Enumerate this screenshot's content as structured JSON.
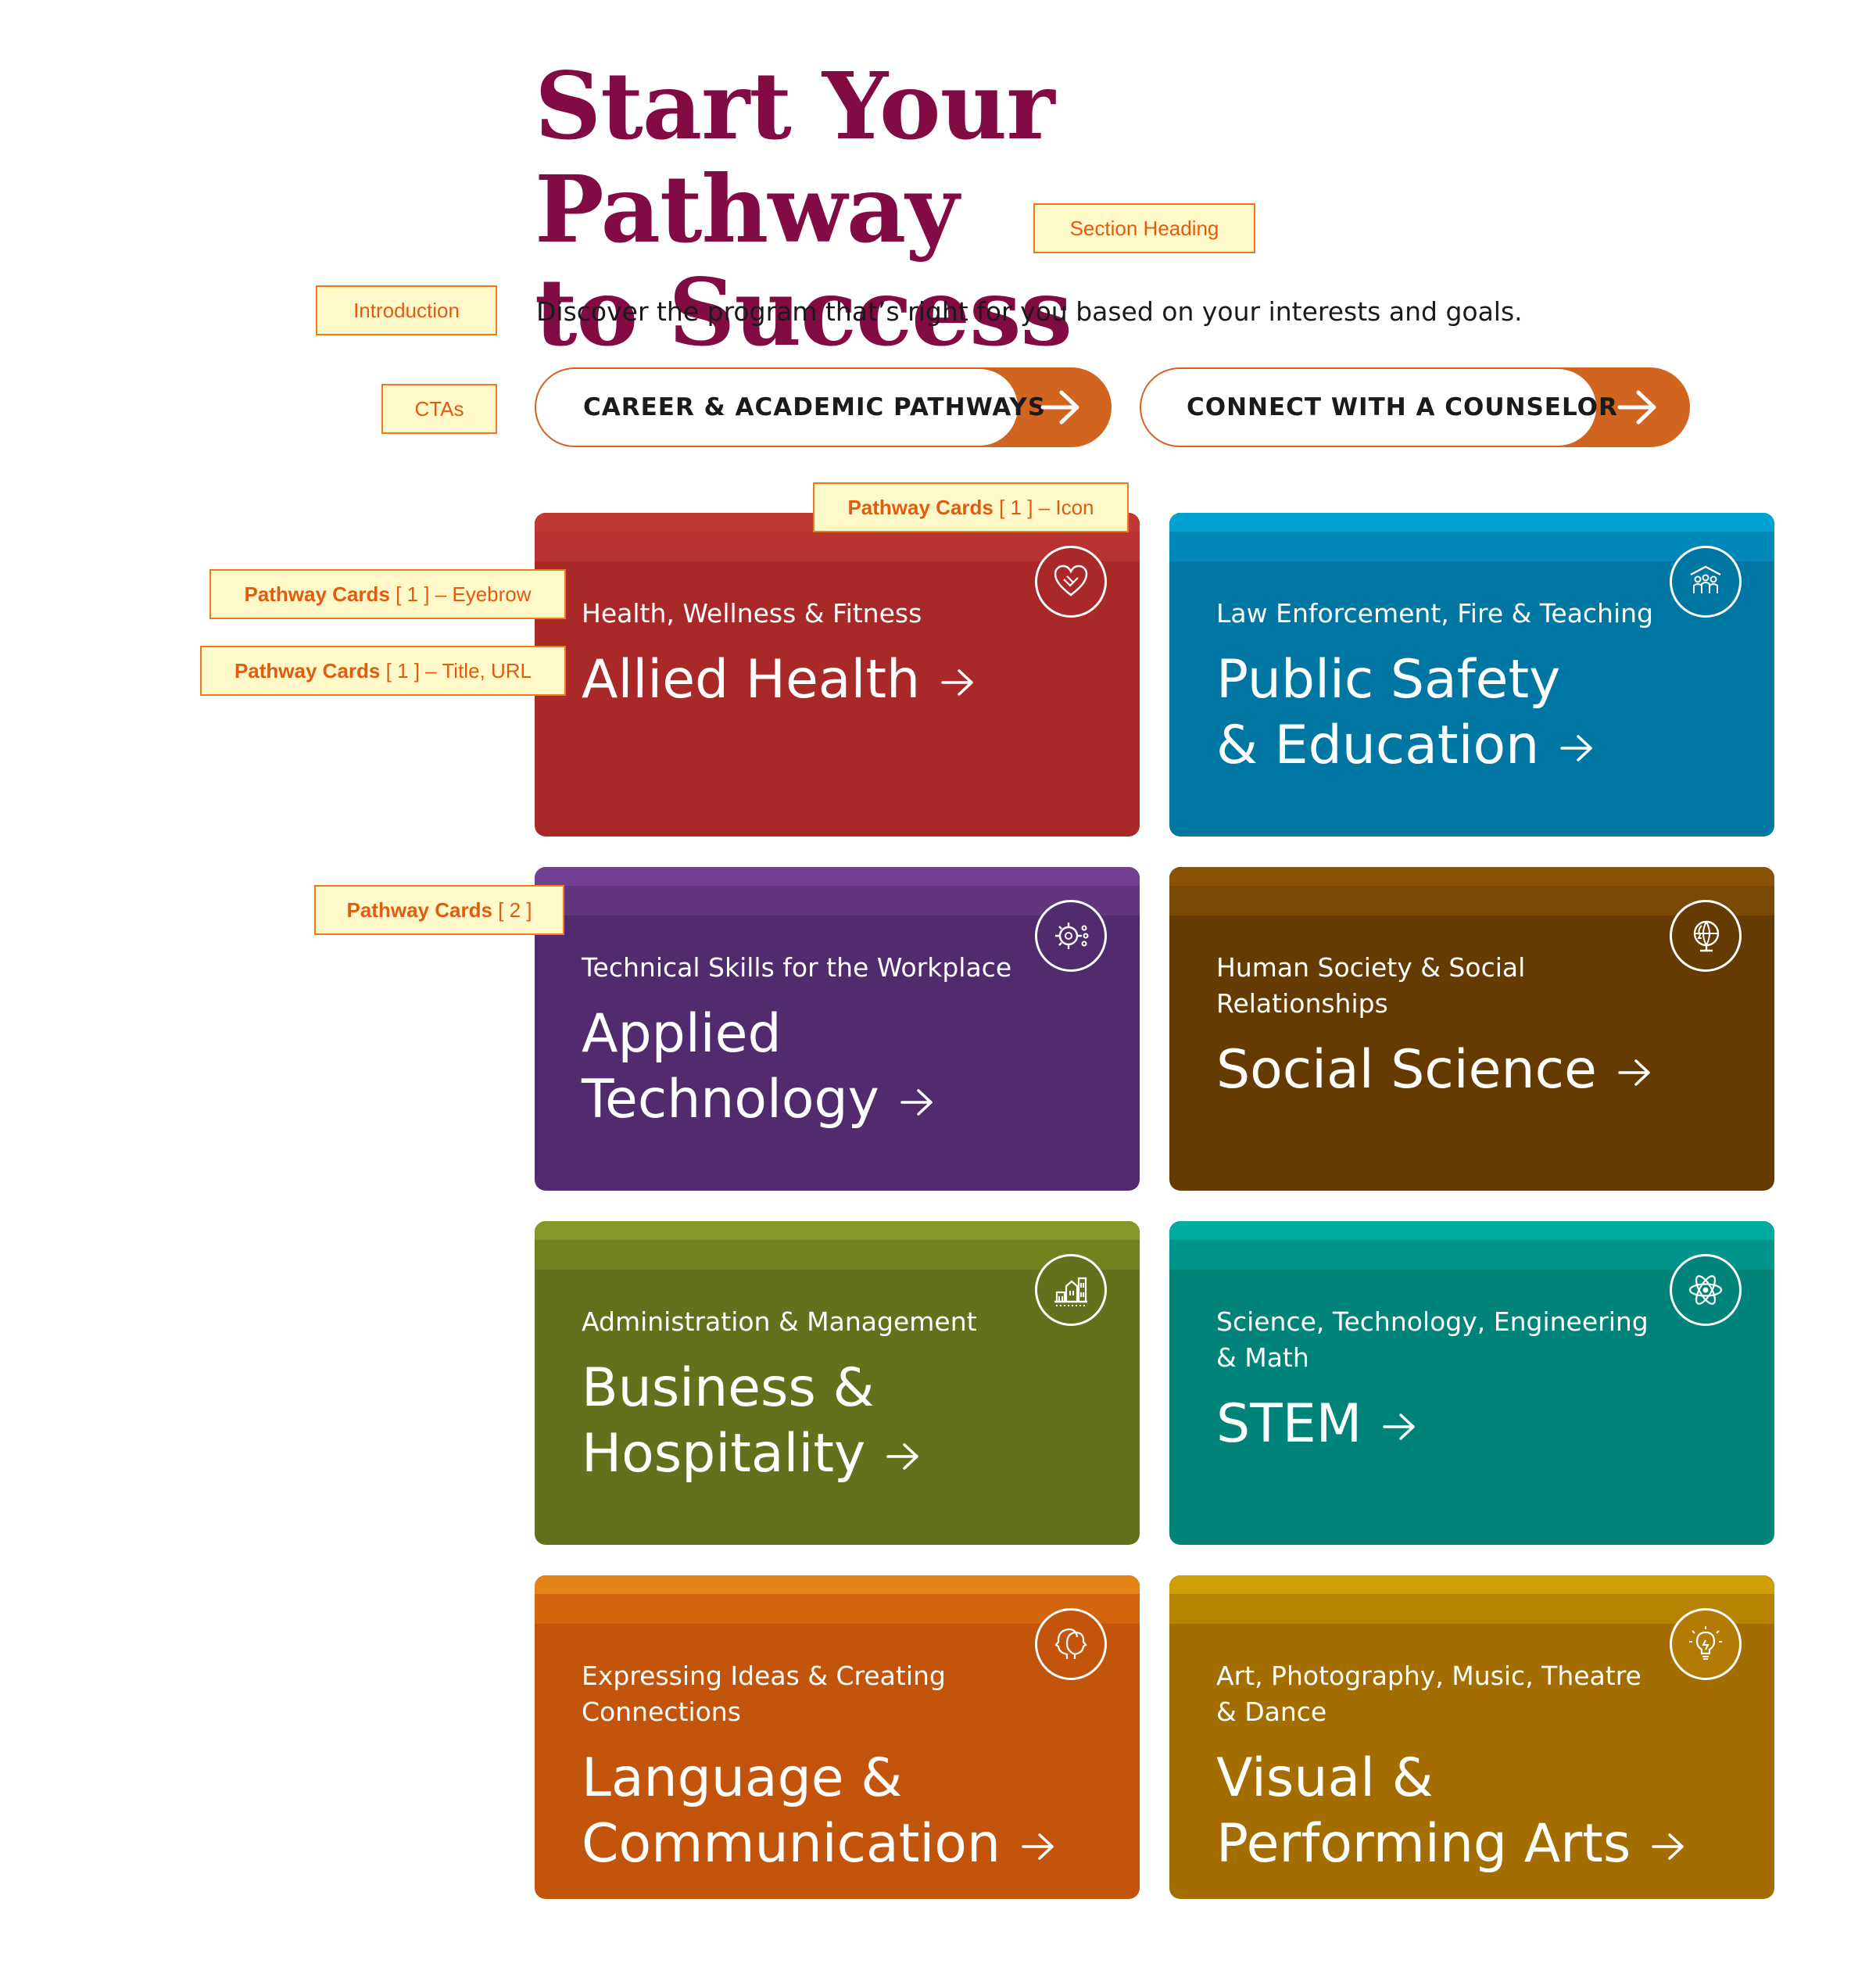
{
  "heading": {
    "line1": "Start Your Pathway",
    "line2": "to Success"
  },
  "intro": "Discover the program that’s right for you based on your interests and goals.",
  "ctas": [
    {
      "label": "CAREER & ACADEMIC PATHWAYS",
      "icon": "arrow-right-icon"
    },
    {
      "label": "CONNECT WITH A COUNSELOR",
      "icon": "arrow-right-icon"
    }
  ],
  "cards": [
    {
      "eyebrow": "Health, Wellness & Fitness",
      "title": "Allied Health",
      "icon": "heart-hand-icon",
      "color": "#a82927"
    },
    {
      "eyebrow": "Law Enforcement, Fire & Teaching",
      "title_line1": "Public Safety",
      "title_line2": "& Education",
      "icon": "people-building-icon",
      "color": "#0077a3"
    },
    {
      "eyebrow": "Technical Skills for the Workplace",
      "title_line1": "Applied",
      "title_line2": "Technology",
      "icon": "chip-gear-icon",
      "color": "#522a6e"
    },
    {
      "eyebrow": "Human Society & Social Relationships",
      "title": "Social Science",
      "icon": "globe-head-icon",
      "color": "#653b01"
    },
    {
      "eyebrow": "Administration & Management",
      "title_line1": "Business &",
      "title_line2": "Hospitality",
      "icon": "buildings-icon",
      "color": "#62711b"
    },
    {
      "eyebrow": "Science, Technology, Engineering & Math",
      "title": "STEM",
      "icon": "atom-icon",
      "color": "#00847a"
    },
    {
      "eyebrow": "Expressing Ideas & Creating Connections",
      "title_line1": "Language &",
      "title_line2": "Communication",
      "icon": "two-faces-icon",
      "color": "#c2540b"
    },
    {
      "eyebrow": "Art, Photography, Music, Theatre & Dance",
      "title_line1": "Visual &",
      "title_line2": "Performing Arts",
      "icon": "lightbulb-icon",
      "color": "#a36d00"
    }
  ],
  "annotations": {
    "section_heading": "Section Heading",
    "introduction": "Introduction",
    "ctas": "CTAs",
    "card_icon_bold": "Pathway Cards",
    "card_icon_rest": " [ 1 ] – Icon",
    "card_eyebrow_bold": "Pathway Cards",
    "card_eyebrow_rest": " [ 1 ] – Eyebrow",
    "card_title_bold": "Pathway Cards",
    "card_title_rest": " [ 1 ] – Title, URL",
    "card2_bold": "Pathway Cards",
    "card2_rest": " [ 2 ]"
  }
}
